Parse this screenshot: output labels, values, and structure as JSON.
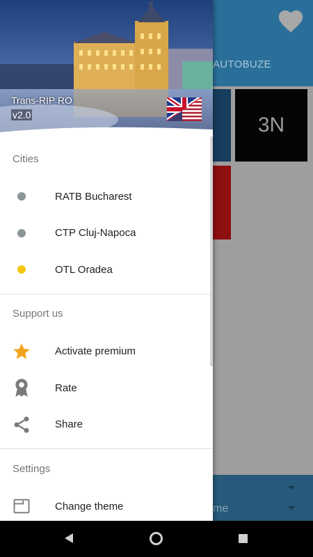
{
  "background_app": {
    "tab_partial": "AUTOBUZE",
    "tile_label": "3N",
    "footer_partial": "me"
  },
  "drawer": {
    "header": {
      "app_name": "Trans-RIP RO",
      "version": "v2.0"
    },
    "sections": [
      {
        "title": "Cities",
        "items": [
          {
            "label": "RATB Bucharest",
            "icon": "dot-icon",
            "color": "#8a9598"
          },
          {
            "label": "CTP Cluj-Napoca",
            "icon": "dot-icon",
            "color": "#8a9598"
          },
          {
            "label": "OTL Oradea",
            "icon": "dot-icon",
            "color": "#f2c811"
          }
        ]
      },
      {
        "title": "Support us",
        "items": [
          {
            "label": "Activate premium",
            "icon": "star-icon",
            "color": "#f2a51c"
          },
          {
            "label": "Rate",
            "icon": "award-icon",
            "color": "#7a7a7a"
          },
          {
            "label": "Share",
            "icon": "share-icon",
            "color": "#7a7a7a"
          }
        ]
      },
      {
        "title": "Settings",
        "items": [
          {
            "label": "Change theme",
            "icon": "theme-icon",
            "color": "#7a7a7a"
          }
        ]
      }
    ]
  },
  "colors": {
    "toolbar": "#2a6f9a",
    "accent_yellow": "#f2c811",
    "star": "#f2a51c"
  }
}
